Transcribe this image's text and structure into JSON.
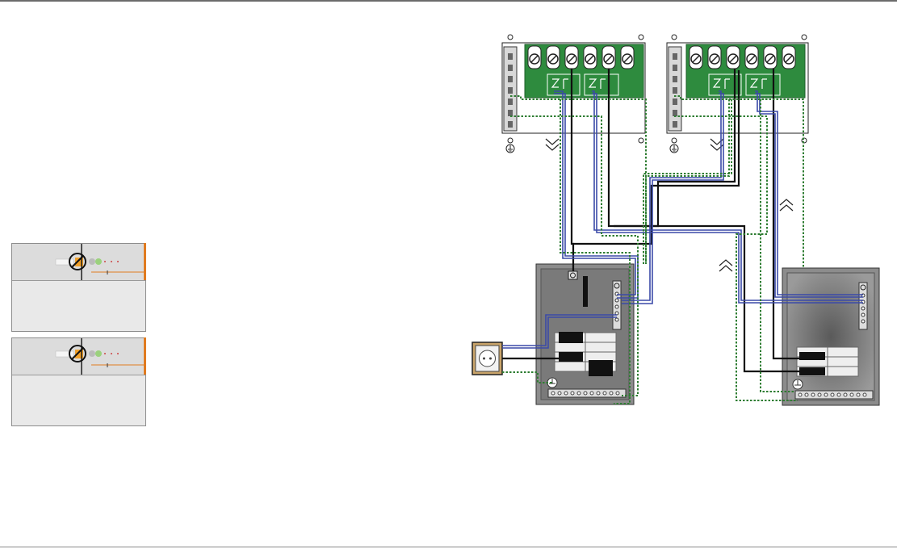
{
  "layout": {
    "top_rule_color": "#6b6b6b",
    "bottom_rule_color": "#8a8a8a"
  },
  "thumbnails": [
    {
      "name": "breaker-panel-thumb-1"
    },
    {
      "name": "breaker-panel-thumb-2"
    }
  ],
  "diagram": {
    "colors": {
      "terminal_board": "#2e8b3e",
      "blue_wire": "#3b4aa8",
      "black_wire": "#111111",
      "ground_wire": "#2e7d32",
      "panel_dark": "#8c8c8c",
      "panel_inner": "#6f6f6f"
    },
    "icons": [
      "ground-symbol-icon",
      "chevron-down-icon",
      "chevron-up-icon",
      "outlet-icon"
    ]
  }
}
